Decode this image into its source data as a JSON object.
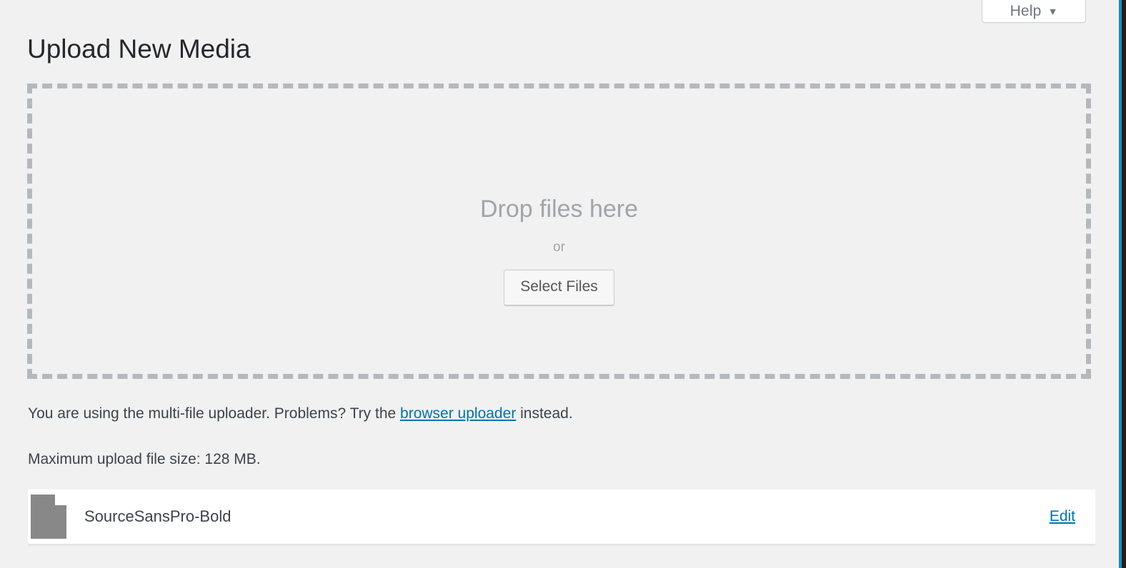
{
  "header": {
    "page_title": "Upload New Media",
    "help_button": {
      "label": "Help",
      "caret": "▼"
    }
  },
  "drop_zone": {
    "headline": "Drop files here",
    "separator": "or",
    "select_button": "Select Files"
  },
  "notices": {
    "uploader_prefix": "You are using the multi-file uploader. Problems? Try the ",
    "uploader_link": "browser uploader",
    "uploader_suffix": " instead.",
    "max_upload": "Maximum upload file size: 128 MB."
  },
  "media_items": [
    {
      "filename": "SourceSansPro-Bold",
      "edit_label": "Edit",
      "icon": "document-icon"
    }
  ],
  "colors": {
    "page_background": "#f1f1f1",
    "dashed_border": "#b4b9be",
    "link": "#0073aa",
    "muted_text": "#a0a5aa",
    "body_text": "#3c434a",
    "title_text": "#23282d",
    "row_background": "#ffffff",
    "accent_edge": "#1e8cbe"
  }
}
